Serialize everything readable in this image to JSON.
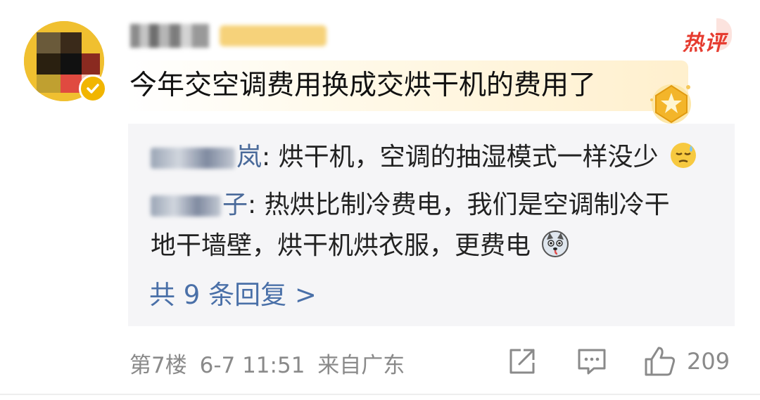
{
  "comment": {
    "hot_tag": "热评",
    "text": "今年交空调费用换成交烘干机的费用了"
  },
  "replies": [
    {
      "name_visible": "岚",
      "text": ": 烘干机，空调的抽湿模式一样没少",
      "emoji": "sleepy-sweat-emoji"
    },
    {
      "name_visible": "子",
      "text_line1": ": 热烘比制冷费电，我们是空调制冷干",
      "text_line2": "地干墙壁，烘干机烘衣服，更费电",
      "emoji": "husky-dog-emoji"
    }
  ],
  "more_replies": "共 9 条回复 >",
  "meta": {
    "floor": "第7楼",
    "date": "6-7 11:51",
    "source": "来自广东"
  },
  "actions": {
    "like_count": "209"
  },
  "colors": {
    "hot": "#e63c30",
    "link": "#4a70a8",
    "meta": "#8a8a8a",
    "reply_bg": "#f5f5f7"
  }
}
